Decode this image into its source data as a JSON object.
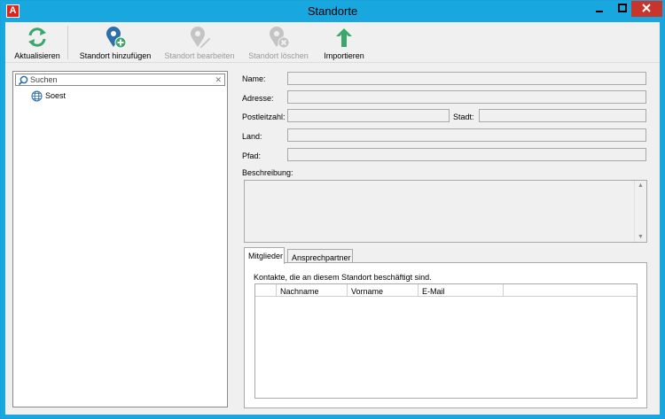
{
  "window": {
    "title": "Standorte",
    "app_icon_letter": "A"
  },
  "toolbar": {
    "refresh": {
      "label": "Aktualisieren",
      "icon": "refresh-icon",
      "enabled": true,
      "color": "#3aa86a"
    },
    "add": {
      "label": "Standort hinzufügen",
      "icon": "location-add-icon",
      "enabled": true,
      "color": "#2f6fa8"
    },
    "edit": {
      "label": "Standort bearbeiten",
      "icon": "location-edit-icon",
      "enabled": false
    },
    "delete": {
      "label": "Standort löschen",
      "icon": "location-delete-icon",
      "enabled": false
    },
    "import": {
      "label": "Importieren",
      "icon": "arrow-up-icon",
      "enabled": true,
      "color": "#3aa86a"
    }
  },
  "search": {
    "placeholder": "Suchen",
    "value": ""
  },
  "tree": {
    "items": [
      {
        "label": "Soest",
        "icon": "globe-icon"
      }
    ]
  },
  "form": {
    "name_label": "Name:",
    "address_label": "Adresse:",
    "zip_label": "Postleitzahl:",
    "city_label": "Stadt:",
    "country_label": "Land:",
    "path_label": "Pfad:",
    "description_label": "Beschreibung:"
  },
  "tabs": [
    {
      "label": "Mitglieder",
      "active": true
    },
    {
      "label": "Ansprechpartner",
      "active": false
    }
  ],
  "members": {
    "description": "Kontakte, die an diesem Standort beschäftigt sind.",
    "columns": [
      "Nachname",
      "Vorname",
      "E-Mail"
    ],
    "rows": []
  },
  "colors": {
    "titlebar": "#19a7e0",
    "close_button": "#c7352d",
    "disabled_text": "#9a9a9a"
  }
}
